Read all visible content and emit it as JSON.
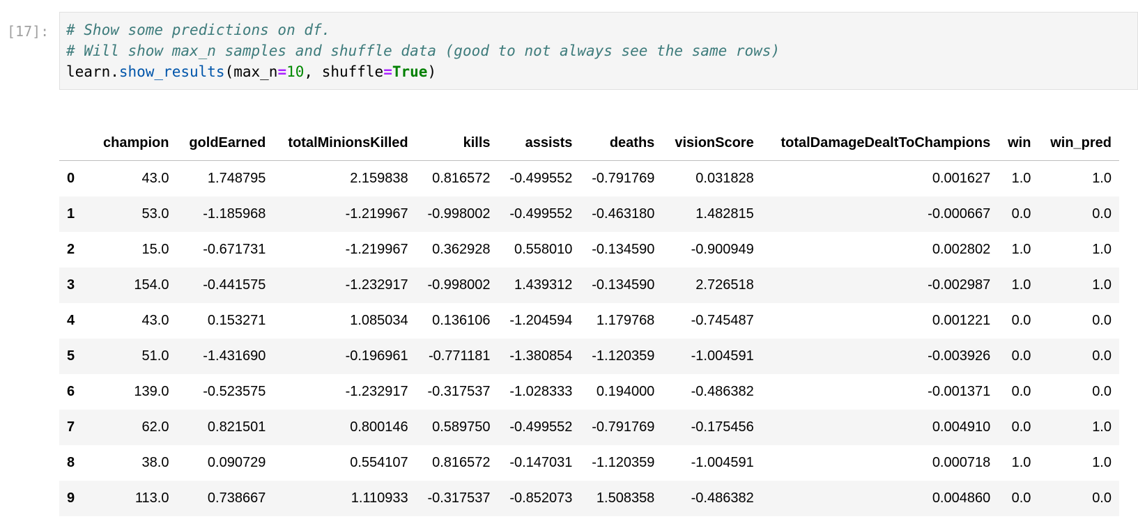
{
  "cell": {
    "prompt": "[17]:",
    "comment1": "# Show some predictions on df.",
    "comment2": "# Will show max_n samples and shuffle data (good to not always see the same rows)",
    "code": {
      "obj": "learn.",
      "fn": "show_results",
      "open": "(",
      "arg1_name": "max_n",
      "eq1": "=",
      "arg1_val": "10",
      "sep": ", ",
      "arg2_name": "shuffle",
      "eq2": "=",
      "arg2_val": "True",
      "close": ")"
    }
  },
  "table": {
    "columns": [
      "",
      "champion",
      "goldEarned",
      "totalMinionsKilled",
      "kills",
      "assists",
      "deaths",
      "visionScore",
      "totalDamageDealtToChampions",
      "win",
      "win_pred"
    ],
    "rows": [
      [
        "0",
        "43.0",
        "1.748795",
        "2.159838",
        "0.816572",
        "-0.499552",
        "-0.791769",
        "0.031828",
        "0.001627",
        "1.0",
        "1.0"
      ],
      [
        "1",
        "53.0",
        "-1.185968",
        "-1.219967",
        "-0.998002",
        "-0.499552",
        "-0.463180",
        "1.482815",
        "-0.000667",
        "0.0",
        "0.0"
      ],
      [
        "2",
        "15.0",
        "-0.671731",
        "-1.219967",
        "0.362928",
        "0.558010",
        "-0.134590",
        "-0.900949",
        "0.002802",
        "1.0",
        "1.0"
      ],
      [
        "3",
        "154.0",
        "-0.441575",
        "-1.232917",
        "-0.998002",
        "1.439312",
        "-0.134590",
        "2.726518",
        "-0.002987",
        "1.0",
        "1.0"
      ],
      [
        "4",
        "43.0",
        "0.153271",
        "1.085034",
        "0.136106",
        "-1.204594",
        "1.179768",
        "-0.745487",
        "0.001221",
        "0.0",
        "0.0"
      ],
      [
        "5",
        "51.0",
        "-1.431690",
        "-0.196961",
        "-0.771181",
        "-1.380854",
        "-1.120359",
        "-1.004591",
        "-0.003926",
        "0.0",
        "0.0"
      ],
      [
        "6",
        "139.0",
        "-0.523575",
        "-1.232917",
        "-0.317537",
        "-1.028333",
        "0.194000",
        "-0.486382",
        "-0.001371",
        "0.0",
        "0.0"
      ],
      [
        "7",
        "62.0",
        "0.821501",
        "0.800146",
        "0.589750",
        "-0.499552",
        "-0.791769",
        "-0.175456",
        "0.004910",
        "0.0",
        "1.0"
      ],
      [
        "8",
        "38.0",
        "0.090729",
        "0.554107",
        "0.816572",
        "-0.147031",
        "-1.120359",
        "-1.004591",
        "0.000718",
        "1.0",
        "1.0"
      ],
      [
        "9",
        "113.0",
        "0.738667",
        "1.110933",
        "-0.317537",
        "-0.852073",
        "1.508358",
        "-0.486382",
        "0.004860",
        "0.0",
        "0.0"
      ]
    ]
  }
}
